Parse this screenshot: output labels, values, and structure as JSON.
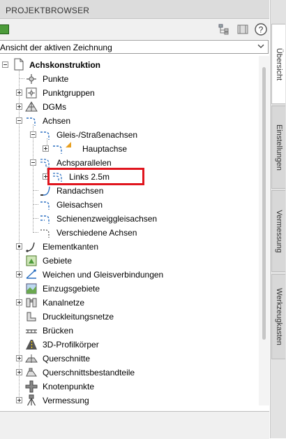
{
  "panel": {
    "title": "PROJEKTBROWSER"
  },
  "dropdown": {
    "value": "Ansicht der aktiven Zeichnung"
  },
  "tabs": [
    "Übersicht",
    "Einstellungen",
    "Vermessung",
    "Werkzeugkasten"
  ],
  "tree": {
    "root": "Achskonstruktion",
    "items": {
      "punkte": "Punkte",
      "punktgruppen": "Punktgruppen",
      "dgms": "DGMs",
      "achsen": "Achsen",
      "gleis_strassenachsen": "Gleis-/Straßenachsen",
      "hauptachse": "Hauptachse",
      "achsparallelen": "Achsparallelen",
      "links": "Links 2.5m",
      "randachsen": "Randachsen",
      "gleisachsen": "Gleisachsen",
      "schienenzweiggleisachsen": "Schienenzweiggleisachsen",
      "verschiedene_achsen": "Verschiedene Achsen",
      "elementkanten": "Elementkanten",
      "gebiete": "Gebiete",
      "weichen": "Weichen und Gleisverbindungen",
      "einzugsgebiete": "Einzugsgebiete",
      "kanalnetze": "Kanalnetze",
      "druckleitungsnetze": "Druckleitungsnetze",
      "bruecken": "Brücken",
      "profilkoerper": "3D-Profilkörper",
      "querschnitte": "Querschnitte",
      "querschnittsbestandteile": "Querschnittsbestandteile",
      "knotenpunkte": "Knotenpunkte",
      "vermessung": "Vermessung"
    }
  },
  "colors": {
    "highlight": "#e0151e",
    "accent_green": "#4c9b3a",
    "icon_blue": "#2a6fc0"
  }
}
